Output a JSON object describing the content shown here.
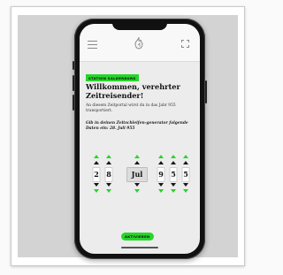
{
  "colors": {
    "accent": "#27d52a",
    "screen_bg": "#ececec",
    "appbar_bg": "#f8f8f8",
    "phone_body": "#111111",
    "backdrop": "#d3d3d3"
  },
  "icons": {
    "menu": "hamburger-menu-icon",
    "logo": "flame-logo-icon",
    "fullscreen": "fullscreen-icon",
    "up": "up-arrow-icon",
    "down": "down-arrow-icon"
  },
  "screen": {
    "station_label": "STATION SALDERBURG",
    "headline": "Willkommen, verehrter Zeitreisender!",
    "intro_text": "An diesem Zeitportal wirst du in das Jahr 955 transportiert.",
    "prompt_text": "Gib in deinen Zeitschleifen-generator folgende Daten ein: 28. Juli 955",
    "picker": {
      "day_digits": [
        "2",
        "8"
      ],
      "month": "Jul",
      "year_digits": [
        "9",
        "5",
        "5"
      ]
    },
    "activate_label": "AKTIVIEREN"
  }
}
